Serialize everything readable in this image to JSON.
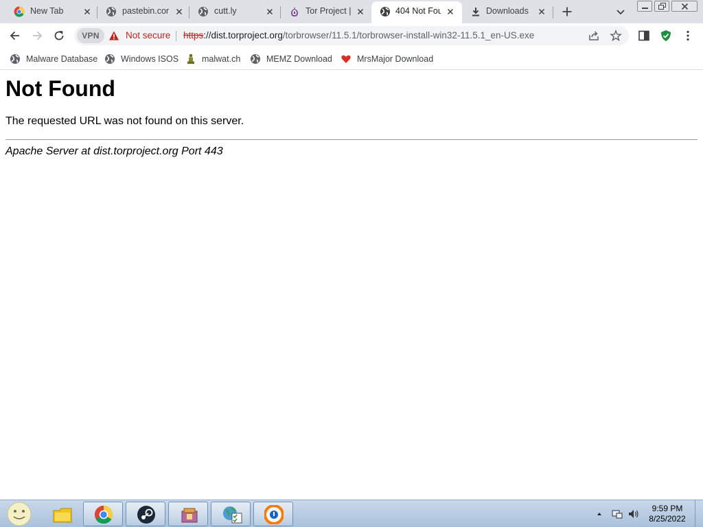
{
  "browser": {
    "tabs": [
      {
        "title": "New Tab",
        "icon": "chrome-icon",
        "active": false
      },
      {
        "title": "pastebin.con",
        "icon": "globe-icon",
        "active": false
      },
      {
        "title": "cutt.ly",
        "icon": "globe-icon",
        "active": false
      },
      {
        "title": "Tor Project |",
        "icon": "onion-icon",
        "active": false
      },
      {
        "title": "404 Not Fou",
        "icon": "globe-icon",
        "active": true
      },
      {
        "title": "Downloads",
        "icon": "download-icon",
        "active": false
      }
    ],
    "toolbar": {
      "vpn_label": "VPN",
      "security_label": "Not secure",
      "url_scheme": "https",
      "url_host": "://dist.torproject.org",
      "url_path": "/torbrowser/11.5.1/torbrowser-install-win32-11.5.1_en-US.exe"
    },
    "bookmarks": [
      {
        "label": "Malware Database",
        "icon": "globe-icon"
      },
      {
        "label": "Windows ISOS",
        "icon": "globe-icon"
      },
      {
        "label": "malwat.ch",
        "icon": "figure-icon"
      },
      {
        "label": "MEMZ Download",
        "icon": "globe-icon"
      },
      {
        "label": "MrsMajor Download",
        "icon": "heart-icon"
      }
    ]
  },
  "page": {
    "heading": "Not Found",
    "message": "The requested URL was not found on this server.",
    "server_signature": "Apache Server at dist.torproject.org Port 443"
  },
  "taskbar": {
    "apps": [
      "file-explorer-icon",
      "chrome-icon",
      "steam-icon",
      "archive-icon",
      "network-tasks-icon",
      "avast-browser-icon"
    ],
    "time": "9:59 PM",
    "date": "8/25/2022"
  },
  "colors": {
    "tab_strip": "#dee1e6",
    "not_secure": "#c5221f",
    "shield_green": "#1e8e3e",
    "heart_red": "#d93025",
    "taskbar": "#b7cce2"
  }
}
